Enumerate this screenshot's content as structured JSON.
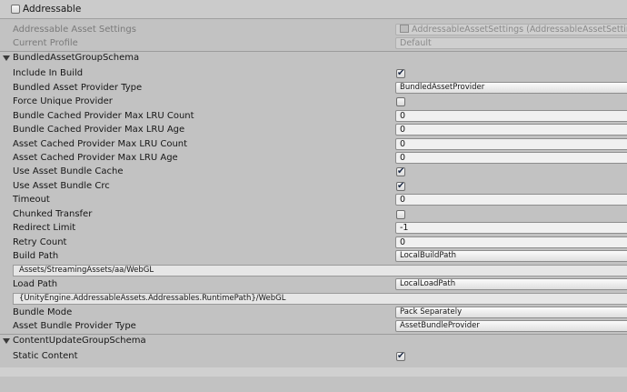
{
  "header": {
    "addressable_label": "Addressable",
    "addressable_checked": false
  },
  "settings": {
    "settings_label": "Addressable Asset Settings",
    "settings_value": "AddressableAssetSettings (AddressableAssetSettings)",
    "profile_label": "Current Profile",
    "profile_value": "Default"
  },
  "bundled": {
    "title": "BundledAssetGroupSchema",
    "include_in_build": "Include In Build",
    "provider_type": "Bundled Asset Provider Type",
    "provider_type_value": "BundledAssetProvider",
    "force_unique": "Force Unique Provider",
    "bundle_lru_count": "Bundle Cached Provider Max LRU Count",
    "bundle_lru_count_value": "0",
    "bundle_lru_age": "Bundle Cached Provider Max LRU Age",
    "bundle_lru_age_value": "0",
    "asset_lru_count": "Asset Cached Provider Max LRU Count",
    "asset_lru_count_value": "0",
    "asset_lru_age": "Asset Cached Provider Max LRU Age",
    "asset_lru_age_value": "0",
    "use_cache": "Use Asset Bundle Cache",
    "use_crc": "Use Asset Bundle Crc",
    "timeout": "Timeout",
    "timeout_value": "0",
    "chunked": "Chunked Transfer",
    "redirect": "Redirect Limit",
    "redirect_value": "-1",
    "retry": "Retry Count",
    "retry_value": "0",
    "build_path": "Build Path",
    "build_path_value": "LocalBuildPath",
    "build_path_resolved": "Assets/StreamingAssets/aa/WebGL",
    "load_path": "Load Path",
    "load_path_value": "LocalLoadPath",
    "load_path_resolved": "{UnityEngine.AddressableAssets.Addressables.RuntimePath}/WebGL",
    "bundle_mode": "Bundle Mode",
    "bundle_mode_value": "Pack Separately",
    "bundle_provider": "Asset Bundle Provider Type",
    "bundle_provider_value": "AssetBundleProvider"
  },
  "content_update": {
    "title": "ContentUpdateGroupSchema",
    "static_content": "Static Content"
  },
  "checks": {
    "include_in_build": true,
    "force_unique": false,
    "use_cache": true,
    "use_crc": true,
    "chunked": false,
    "static_content": true
  }
}
